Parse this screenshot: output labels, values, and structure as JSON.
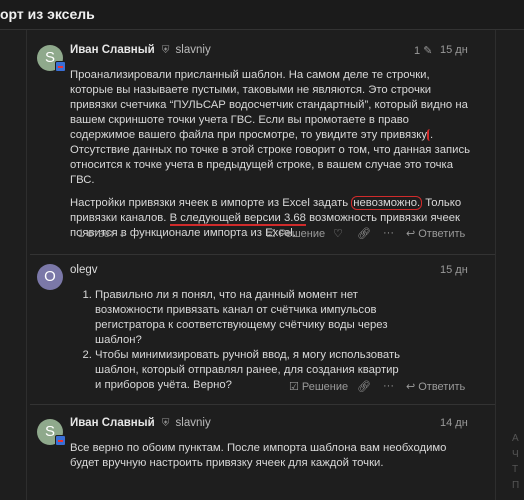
{
  "page": {
    "title": "орт из эксель"
  },
  "posts": [
    {
      "avatar_letter": "S",
      "author_name": "Иван Славный",
      "author_login": "slavniy",
      "edits": "1",
      "date": "15 дн",
      "para1": {
        "a": "Проанализировали присланный шаблон. На самом деле те строчки, которые вы называете пустыми, таковыми не являются. Это строчки привязки счетчика “ПУЛЬСАР водосчетчик стандартный”, который видно на вашем скриншоте точки учета ГВС. Если вы промотаете в право содержимое вашего файла при просмотре, то увидите эту привязку",
        "b": ". Отсутствие данных по точке в этой строке говорит о том, что данная запись относится к точке учета в предыдущей строке, в вашем случае это точка ГВС."
      },
      "para2": {
        "a": "Настройки привязки ячеек в импорте из Excel задать ",
        "hl": "невозможно.",
        "b": " Только привязки каналов. ",
        "ul": "В следующей версии 3.68",
        "c": " возможность привязки ячеек появится в функционале импорта из Excel."
      },
      "replies_label": "1 ответ",
      "solution_label": "Решение",
      "reply_label": "Ответить"
    },
    {
      "avatar_letter": "O",
      "author_name": "olegv",
      "date": "15 дн",
      "items": [
        "Правильно ли я понял, что на данный момент нет возможности привязать канал от счётчика импульсов регистратора к соответствующему счётчику воды через шаблон?",
        "Чтобы минимизировать ручной ввод, я могу использовать шаблон, который отправлял ранее, для создания квартир и приборов учёта. Верно?"
      ],
      "solution_label": "Решение",
      "reply_label": "Ответить"
    },
    {
      "avatar_letter": "S",
      "author_name": "Иван Славный",
      "author_login": "slavniy",
      "date": "14 дн",
      "text": "Все верно по обоим пунктам. После импорта шаблона вам необходимо будет вручную настроить привязку ячеек для каждой точки."
    }
  ],
  "side_fragments": [
    "А",
    "Ч",
    "Т",
    "П"
  ]
}
